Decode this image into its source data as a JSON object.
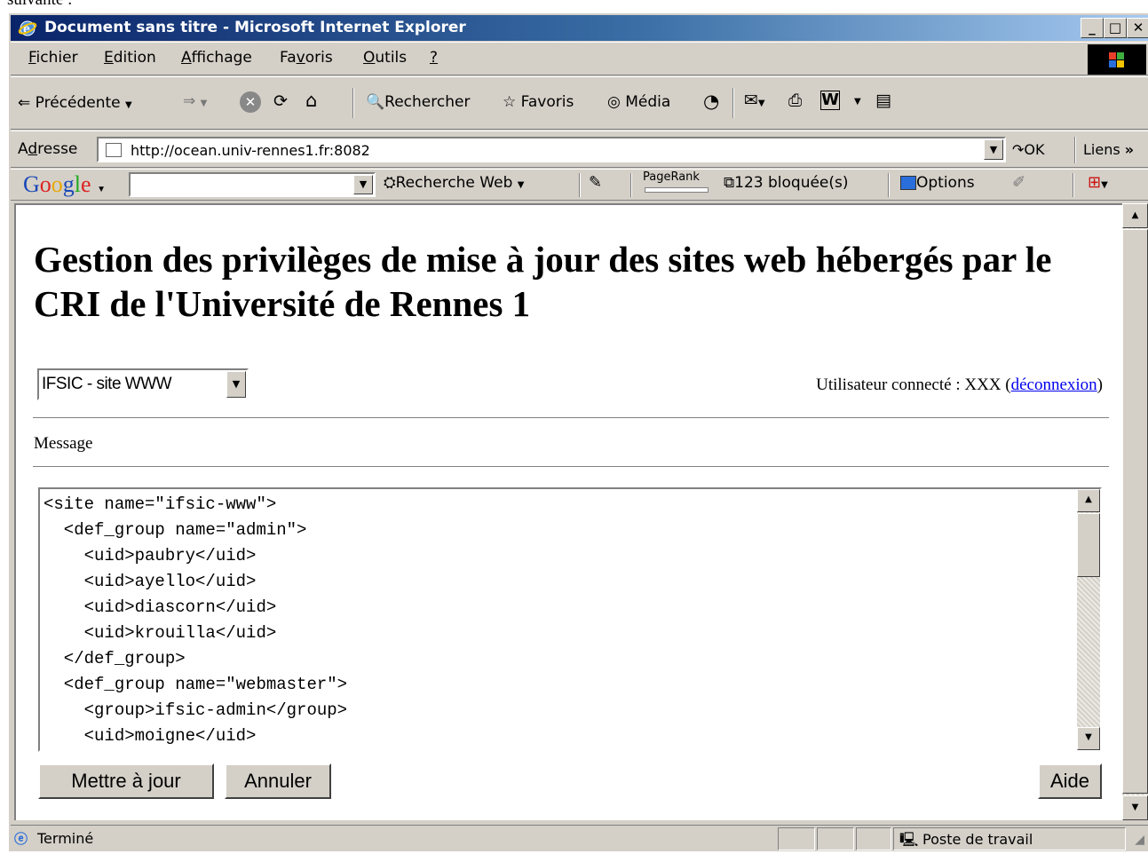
{
  "window": {
    "title": "Document sans titre - Microsoft Internet Explorer",
    "minimize": "_",
    "maximize": "□",
    "close": "✕"
  },
  "above_window_text": "suivante :",
  "menu": {
    "items": [
      {
        "key": "F",
        "rest": "ichier"
      },
      {
        "key": "E",
        "rest": "dition"
      },
      {
        "key": "A",
        "rest": "ffichage"
      },
      {
        "pre": "Fa",
        "key": "v",
        "rest": "oris"
      },
      {
        "key": "O",
        "rest": "utils"
      },
      {
        "key": "?",
        "rest": ""
      }
    ]
  },
  "toolbar": {
    "back": "Précédente",
    "search": "Rechercher",
    "favorites": "Favoris",
    "media": "Média"
  },
  "address": {
    "label_key": "d",
    "label_pre": "A",
    "label_rest": "resse",
    "url": "http://ocean.univ-rennes1.fr:8082",
    "go": "OK",
    "links": "Liens"
  },
  "google_bar": {
    "logo_G": "G",
    "logo_o1": "o",
    "logo_o2": "o",
    "logo_g": "g",
    "logo_l": "l",
    "logo_e": "e",
    "search_value": "",
    "web_search": "Recherche Web",
    "pagerank": "PageRank",
    "blocked": "123 bloquée(s)",
    "options": "Options"
  },
  "page": {
    "title": "Gestion des privilèges de mise à jour des sites web hébergés par le CRI de l'Université de Rennes 1",
    "site_select_value": "IFSIC - site WWW",
    "user_prefix": "Utilisateur connecté : XXX (",
    "logout_link": "déconnexion",
    "user_suffix": ")",
    "message_label": "Message",
    "xml_content": "<site name=\"ifsic-www\">\n  <def_group name=\"admin\">\n    <uid>paubry</uid>\n    <uid>ayello</uid>\n    <uid>diascorn</uid>\n    <uid>krouilla</uid>\n  </def_group>\n  <def_group name=\"webmaster\">\n    <group>ifsic-admin</group>\n    <uid>moigne</uid>",
    "update_button": "Mettre à jour",
    "cancel_button": "Annuler",
    "help_button": "Aide"
  },
  "status": {
    "text": "Terminé",
    "zone": "Poste de travail"
  },
  "colors": {
    "title_bar_start": "#0a246a",
    "title_bar_end": "#a6caf0",
    "link": "#0000ee",
    "chrome": "#d4d0c8"
  }
}
